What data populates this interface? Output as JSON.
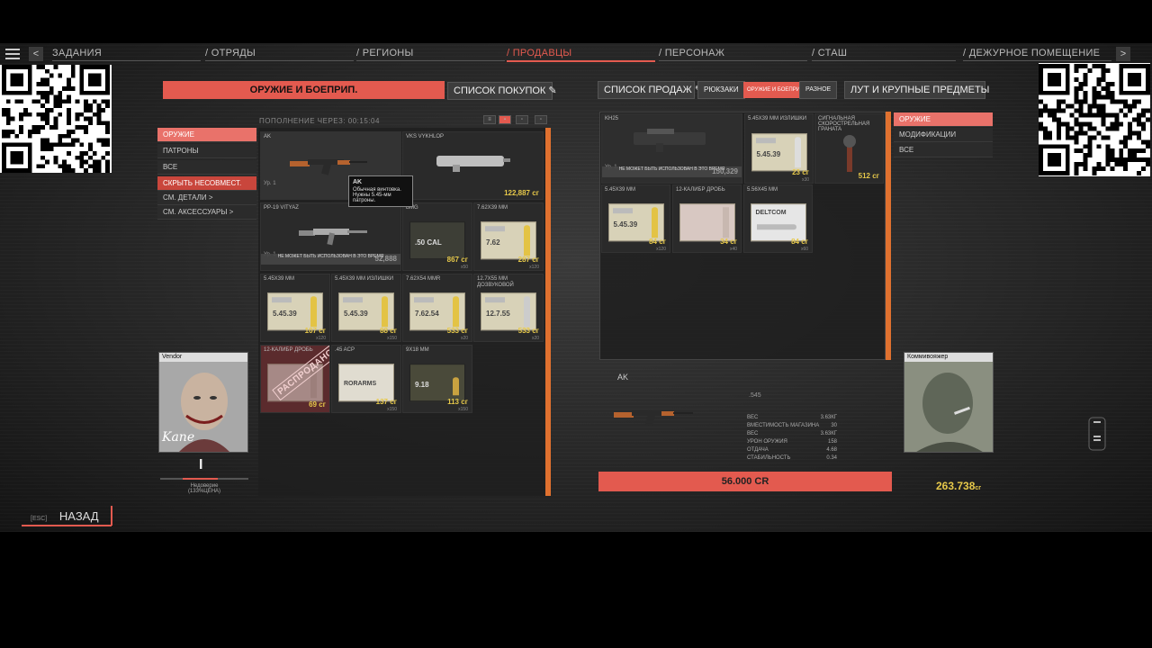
{
  "nav": {
    "tabs": [
      "ЗАДАНИЯ",
      "/ ОТРЯДЫ",
      "/ РЕГИОНЫ",
      "/ ПРОДАВЦЫ",
      "/ ПЕРСОНАЖ",
      "/ СТАШ",
      "/ ДЕЖУРНОЕ ПОМЕЩЕНИЕ"
    ],
    "active_tab": "/ ПРОДАВЦЫ",
    "prev": "<",
    "next": ">"
  },
  "vendor_panel": {
    "title": "ОРУЖИЕ И БОЕПРИП.",
    "buy_list_button": "СПИСОК ПОКУПОК",
    "timer": "ПОПОЛНЕНИЕ ЧЕРЕЗ: 00:15:04",
    "categories": [
      "ОРУЖИЕ",
      "ПАТРОНЫ",
      "ВСЕ"
    ],
    "filters": [
      "СКРЫТЬ НЕСОВМЕСТ.",
      "СМ. ДЕТАЛИ >",
      "СМ. АКСЕССУАРЫ >"
    ],
    "items": [
      {
        "name": "AK",
        "level": "Ур. 1",
        "price": "",
        "qty": ""
      },
      {
        "name": "VKS VYKHLOP",
        "price": "122,887",
        "unit": "сг",
        "qty": ""
      },
      {
        "name": "PP-19 VITYAZ",
        "level": "Ур. 1",
        "warning": "НЕ МОЖЕТ БЫТЬ ИСПОЛЬЗОВАН В ЭТО ВРЕМЯ",
        "price": "52,888",
        "qty": ""
      },
      {
        "name": "BMG",
        "box": ".50 CAL",
        "price": "867",
        "unit": "сг",
        "qty": "x50"
      },
      {
        "name": "7.62X39 MM",
        "box": "7.62",
        "price": "287",
        "unit": "сг",
        "qty": "x120"
      },
      {
        "name": "5.45X39 MM",
        "box": "5.45.39",
        "price": "107",
        "unit": "сг",
        "qty": "x120"
      },
      {
        "name": "5.45X39 MM ИЗЛИШКИ",
        "box": "5.45.39",
        "price": "88",
        "unit": "сг",
        "qty": "x150"
      },
      {
        "name": "7.62X54 MMR",
        "box": "7.62.54",
        "price": "533",
        "unit": "сг",
        "qty": "x20"
      },
      {
        "name": "12.7X55 MM ДОЗВУКОВОЙ",
        "box": "12.7.55",
        "price": "533",
        "unit": "сг",
        "qty": "x20"
      },
      {
        "name": "12-КАЛИБР ДРОБЬ",
        "stamp": "РАСПРОДАНО",
        "price": "69",
        "unit": "сг",
        "qty": ""
      },
      {
        "name": ".45 ACP",
        "box": "RORARMS",
        "price": "137",
        "unit": "сг",
        "qty": "x150"
      },
      {
        "name": "9X18 MM",
        "box": "9.18",
        "price": "113",
        "unit": "сг",
        "qty": "x150"
      }
    ],
    "tooltip": {
      "title": "AK",
      "text": "Обычная винтовка. Нужны 5.45-мм патроны."
    },
    "portrait_name": "Vendor",
    "signature": "Kane",
    "relation_label": "Недоверие",
    "relation_value": "(133%ЦЕНА)"
  },
  "player_panel": {
    "sell_list_button": "СПИСОК ПРОДАЖ",
    "tab_backpacks": "РЮКЗАКИ",
    "tab_active": "ОРУЖИЕ И БОЕПРИП.",
    "tab_misc": "РАЗНОЕ",
    "tab_loot": "ЛУТ И КРУПНЫЕ ПРЕДМЕТЫ",
    "categories": [
      "ОРУЖИЕ",
      "МОДИФИКАЦИИ",
      "ВСЕ"
    ],
    "items": [
      {
        "name": "KH25",
        "level": "Ур. 1",
        "warning": "НЕ МОЖЕТ БЫТЬ ИСПОЛЬЗОВАН В ЭТО ВРЕМЯ",
        "price": "150,329",
        "qty": ""
      },
      {
        "name": "5.45X39 MM ИЗЛИШКИ",
        "box": "5.45.39",
        "price": "23",
        "unit": "сг",
        "qty": "x30"
      },
      {
        "name": "СИГНАЛЬНАЯ СКОРОСТРЕЛЬНАЯ ГРАНАТА",
        "price": "512",
        "unit": "сг",
        "qty": ""
      },
      {
        "name": "5.45X39 MM",
        "box": "5.45.39",
        "price": "84",
        "unit": "сг",
        "qty": "x120"
      },
      {
        "name": "12-КАЛИБР ДРОБЬ",
        "price": "34",
        "unit": "сг",
        "qty": "x40"
      },
      {
        "name": "5.56X45 MM",
        "box": "DELTCOM",
        "price": "84",
        "unit": "сг",
        "qty": "x60"
      }
    ],
    "portrait_name": "Коммивояжер"
  },
  "detail": {
    "name": "AK",
    "caliber": ".545",
    "stats": [
      {
        "label": "ВЕС",
        "value": "3.63КГ"
      },
      {
        "label": "ВМЕСТИМОСТЬ МАГАЗИНА",
        "value": "30"
      },
      {
        "label": "ВЕС",
        "value": "3.63КГ"
      },
      {
        "label": "УРОН ОРУЖИЯ",
        "value": "158"
      },
      {
        "label": "ОТДАЧА",
        "value": "4.68"
      },
      {
        "label": "СТАБИЛЬНОСТЬ",
        "value": "0.34"
      }
    ],
    "buy_price": "56.000 CR",
    "player_money": "263.738",
    "money_unit": "сг"
  },
  "footer": {
    "esc": "[ESC]",
    "back": "НАЗАД"
  },
  "colors": {
    "accent": "#e35a4f",
    "gold": "#e6c84a",
    "rail": "#e0712f"
  }
}
